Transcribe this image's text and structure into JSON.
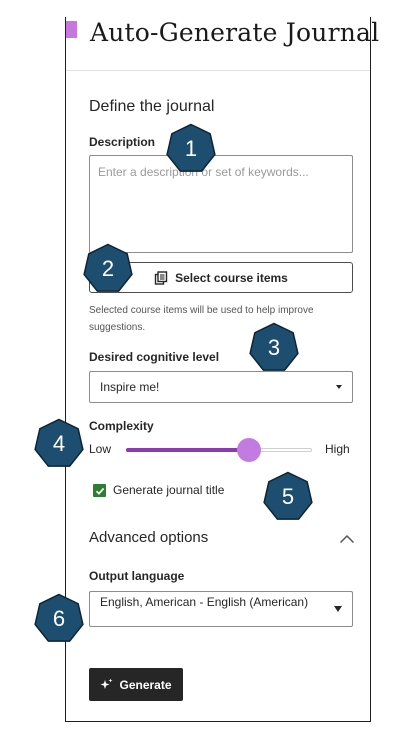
{
  "header": {
    "title": "Auto-Generate Journal"
  },
  "section": {
    "title": "Define the journal"
  },
  "description": {
    "label": "Description",
    "placeholder": "Enter a description or set of keywords..."
  },
  "course_items": {
    "button_label": "Select course items",
    "helper_text": "Selected course items will be used to help improve suggestions."
  },
  "cognitive_level": {
    "label": "Desired cognitive level",
    "selected": "Inspire me!"
  },
  "complexity": {
    "label": "Complexity",
    "low_label": "Low",
    "high_label": "High",
    "level": 0.66
  },
  "journal_title_checkbox": {
    "label": "Generate journal title",
    "checked": true
  },
  "advanced": {
    "title": "Advanced options",
    "expanded": true
  },
  "output_language": {
    "label": "Output language",
    "selected": "English, American - English (American)"
  },
  "generate": {
    "label": "Generate"
  },
  "callouts": [
    "1",
    "2",
    "3",
    "4",
    "5",
    "6"
  ],
  "colors": {
    "accent": "#c777e0",
    "slider_fill": "#8b3ab0",
    "slider_thumb": "#c27be0",
    "checkbox": "#2e7d32",
    "callout": "#1d4e6f",
    "primary_button": "#262626"
  },
  "icons": {
    "course_items": "copy-pages-icon",
    "generate": "sparkle-icon",
    "advanced_toggle": "chevron-up-icon"
  }
}
